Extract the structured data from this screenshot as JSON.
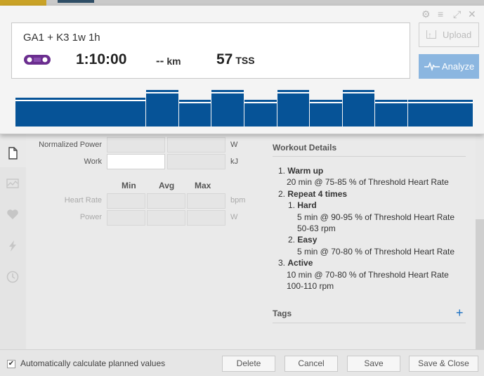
{
  "header": {
    "title": "GA1 + K3 1w 1h",
    "duration": "1:10:00",
    "distance_value": "--",
    "distance_unit": "km",
    "tss_value": "57",
    "tss_unit": "TSS",
    "upload_label": "Upload",
    "analyze_label": "Analyze",
    "accent_color": "#065397",
    "sport_icon": "bike-chain-icon"
  },
  "profile": {
    "label": "workout intensity profile",
    "segments": [
      {
        "name": "Warm up",
        "minutes": 20,
        "level": 0.75
      },
      {
        "name": "Hard",
        "minutes": 5,
        "level": 0.9
      },
      {
        "name": "Easy",
        "minutes": 5,
        "level": 0.7
      },
      {
        "name": "Hard",
        "minutes": 5,
        "level": 0.9
      },
      {
        "name": "Easy",
        "minutes": 5,
        "level": 0.7
      },
      {
        "name": "Hard",
        "minutes": 5,
        "level": 0.9
      },
      {
        "name": "Easy",
        "minutes": 5,
        "level": 0.7
      },
      {
        "name": "Hard",
        "minutes": 5,
        "level": 0.9
      },
      {
        "name": "Easy",
        "minutes": 5,
        "level": 0.7
      },
      {
        "name": "Active",
        "minutes": 10,
        "level": 0.7
      }
    ]
  },
  "fields": {
    "normalized_power_label": "Normalized Power",
    "normalized_power_unit": "W",
    "work_label": "Work",
    "work_unit": "kJ",
    "col_min": "Min",
    "col_avg": "Avg",
    "col_max": "Max",
    "heart_rate_label": "Heart Rate",
    "heart_rate_unit": "bpm",
    "power_label": "Power",
    "power_unit": "W"
  },
  "details": {
    "title": "Workout Details",
    "steps": [
      {
        "num": "1.",
        "name": "Warm up"
      },
      {
        "line": "20 min @ 75-85 % of Threshold Heart Rate"
      },
      {
        "num": "2.",
        "name": "Repeat 4 times"
      },
      {
        "num": "1.",
        "name": "Hard"
      },
      {
        "line": "5 min @ 90-95 % of Threshold Heart Rate"
      },
      {
        "line": "50-63 rpm"
      },
      {
        "num": "2.",
        "name": "Easy"
      },
      {
        "line": "5 min @ 70-80 % of Threshold Heart Rate"
      },
      {
        "num": "3.",
        "name": "Active"
      },
      {
        "line": "10 min @ 70-80 % of Threshold Heart Rate"
      },
      {
        "line": "100-110 rpm"
      }
    ]
  },
  "tags": {
    "title": "Tags",
    "add": "+"
  },
  "footer": {
    "auto_calc_label": "Automatically calculate planned values",
    "auto_calc_checked": "✔",
    "delete_label": "Delete",
    "cancel_label": "Cancel",
    "save_label": "Save",
    "save_close_label": "Save & Close"
  },
  "window": {
    "gear": "⚙",
    "menu": "≡",
    "expand": "⤢",
    "close": "✕"
  }
}
